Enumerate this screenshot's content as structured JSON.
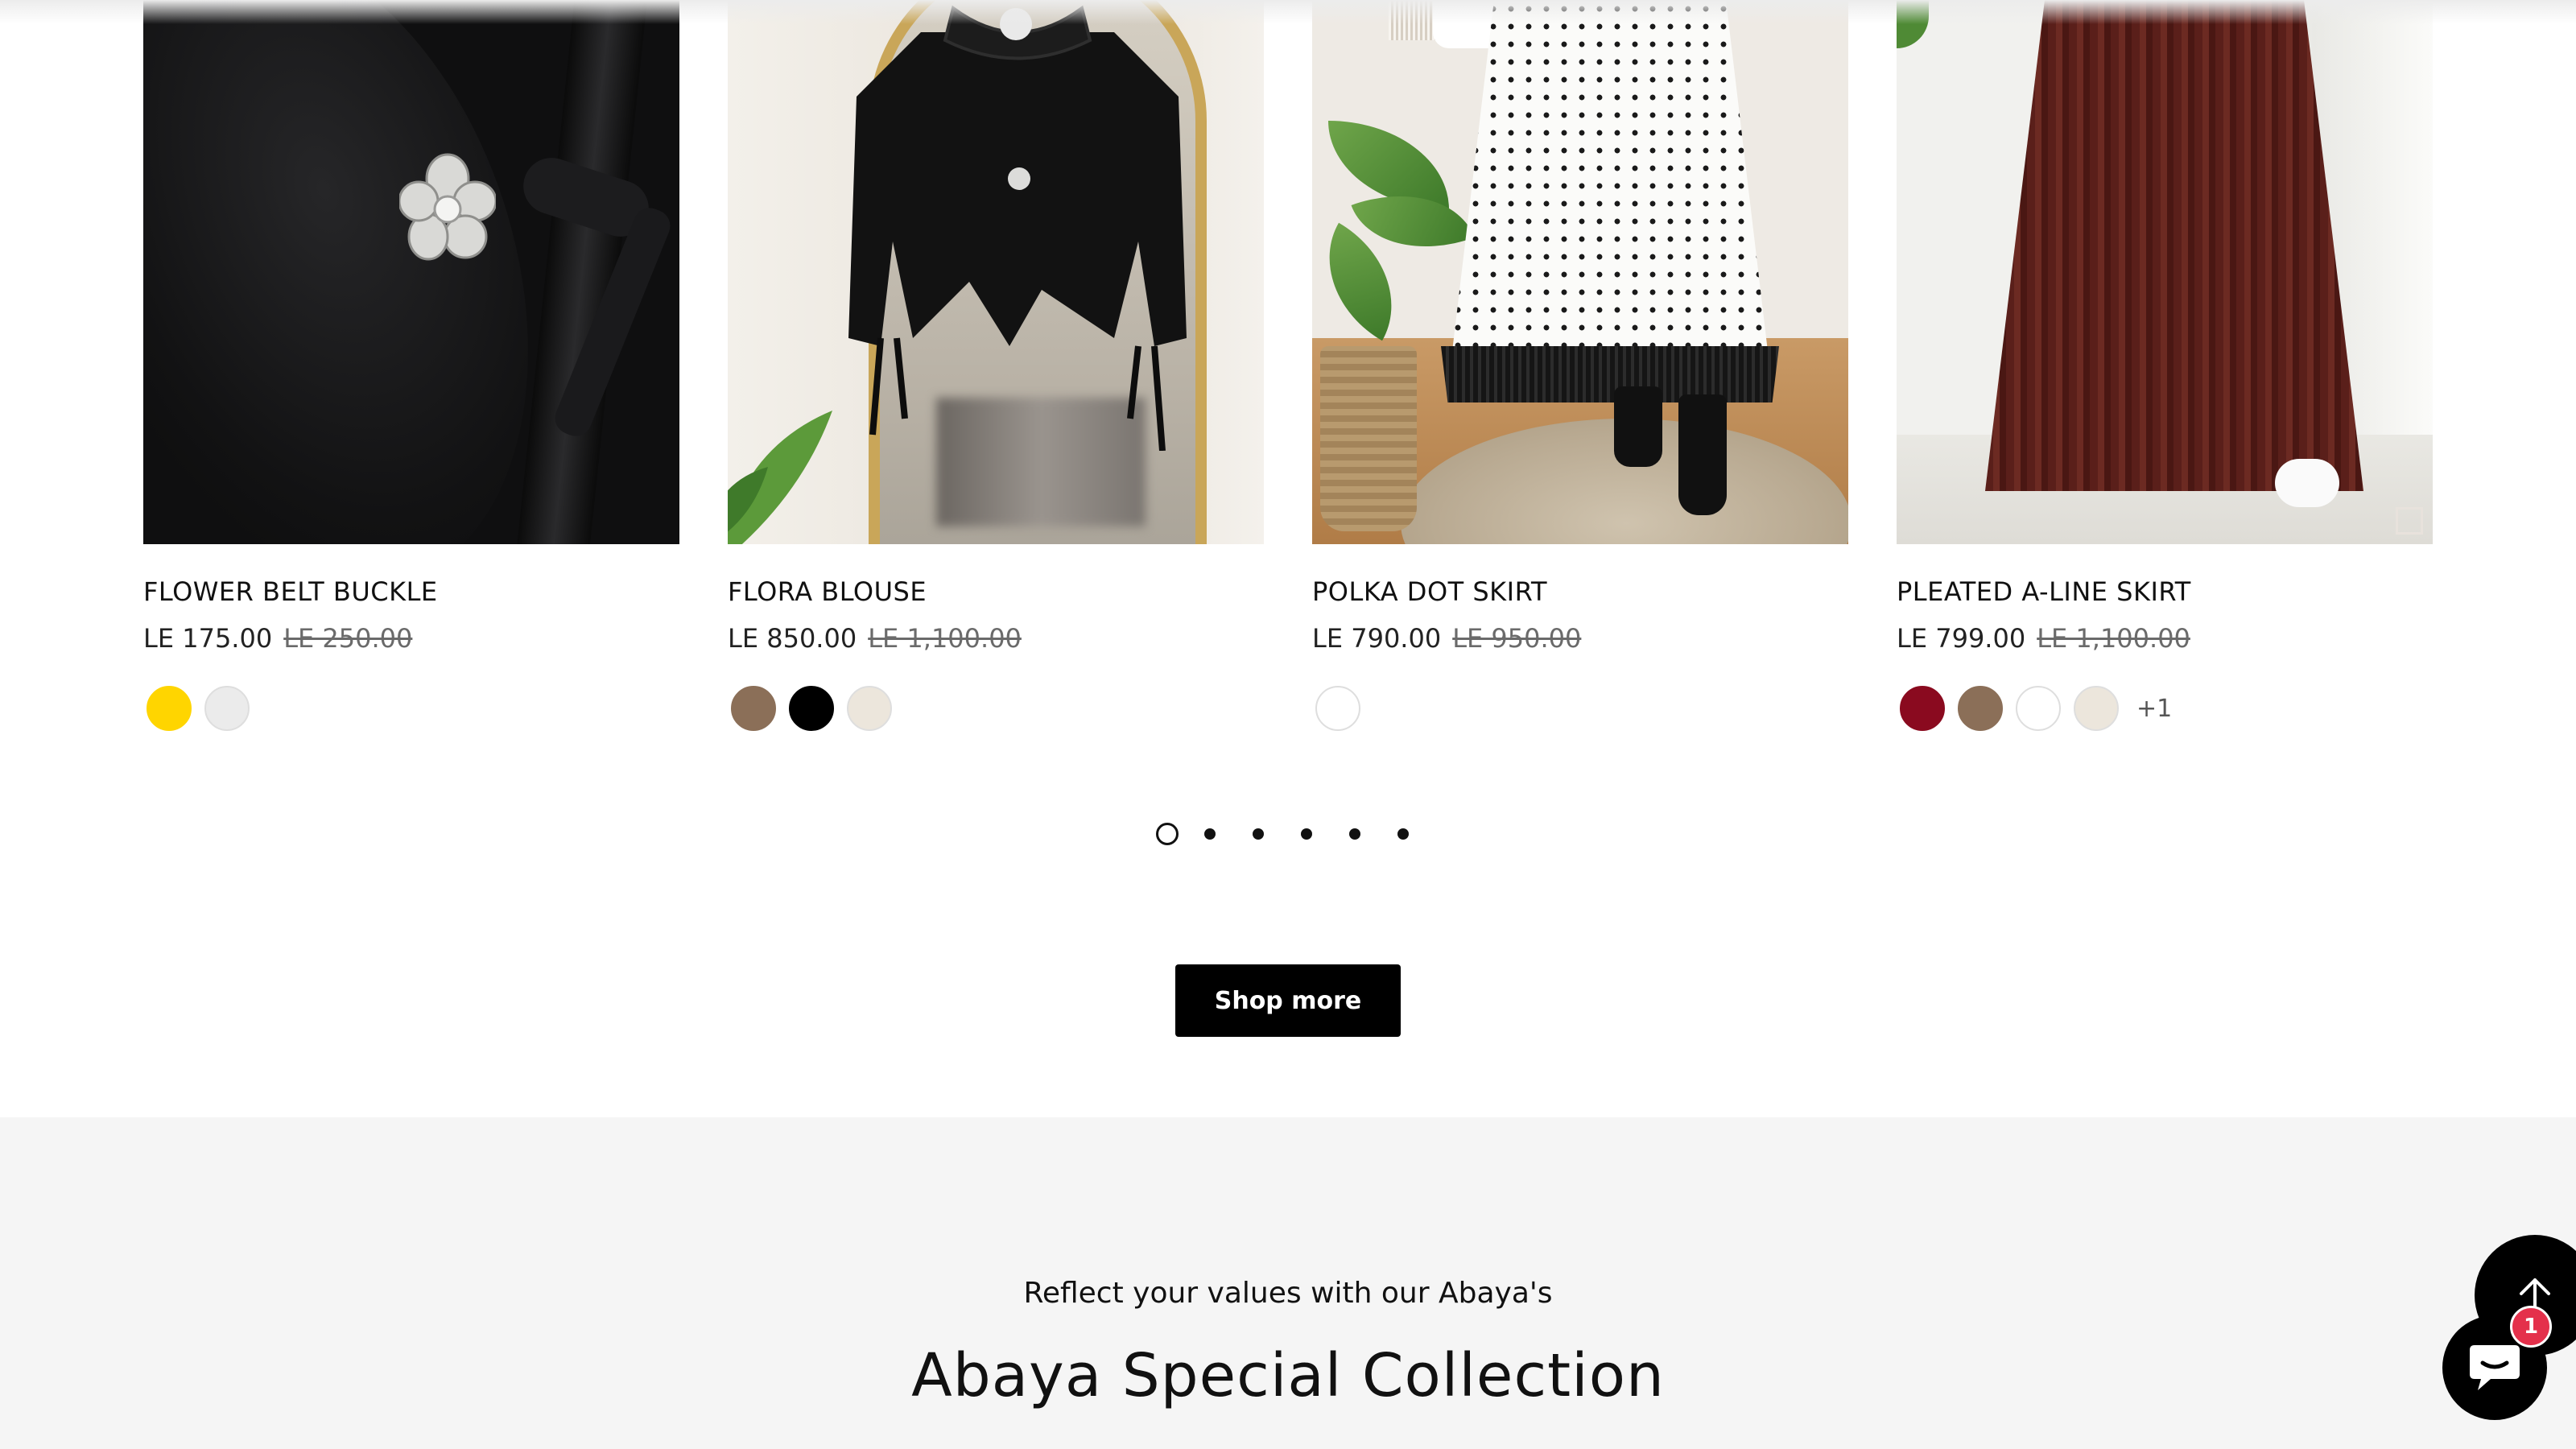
{
  "products": [
    {
      "name": "FLOWER BELT BUCKLE",
      "price": "LE 175.00",
      "compare_price": "LE 250.00",
      "swatches": [
        "#FFD500",
        "#EBEBEB"
      ],
      "more": ""
    },
    {
      "name": "FLORA BLOUSE",
      "price": "LE 850.00",
      "compare_price": "LE 1,100.00",
      "swatches": [
        "#8B6F58",
        "#000000",
        "#ECE6DC"
      ],
      "more": ""
    },
    {
      "name": "POLKA DOT SKIRT",
      "price": "LE 790.00",
      "compare_price": "LE 950.00",
      "swatches": [
        "#FFFFFF"
      ],
      "more": ""
    },
    {
      "name": "PLEATED A-LINE SKIRT",
      "price": "LE 799.00",
      "compare_price": "LE 1,100.00",
      "swatches": [
        "#8A0A1F",
        "#8B6F58",
        "#FFFFFF",
        "#ECE6DC"
      ],
      "more": "+1"
    }
  ],
  "pagination": {
    "count": 6,
    "active_index": 0
  },
  "shop_more": {
    "label": "Shop more"
  },
  "collection": {
    "subtitle": "Reflect your values with our Abaya's",
    "title": "Abaya Special Collection"
  },
  "floating": {
    "back_to_top_icon": "arrow-up-icon",
    "chat_icon": "chat-bubble-icon",
    "chat_badge": "1"
  },
  "colors": {
    "accent": "#000000",
    "section_bg": "#F5F5F5",
    "badge": "#E4304B"
  }
}
